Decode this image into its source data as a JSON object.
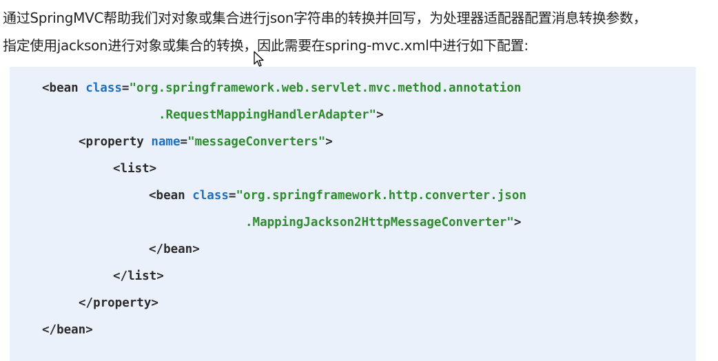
{
  "intro": {
    "line1": "通过SpringMVC帮助我们对对象或集合进行json字符串的转换并回写，为处理器适配器配置消息转换参数，",
    "line2": "指定使用jackson进行对象或集合的转换，因此需要在spring-mvc.xml中进行如下配置:"
  },
  "code": {
    "l1_open": "<bean ",
    "l1_attr": "class",
    "l1_eq": "=",
    "l1_val": "\"org.springframework.web.servlet.mvc.method.annotation",
    "l2_val": ".RequestMappingHandlerAdapter\"",
    "l2_close": ">",
    "l3_open": "<property ",
    "l3_attr": "name",
    "l3_eq": "=",
    "l3_val": "\"messageConverters\"",
    "l3_close": ">",
    "l4": "<list>",
    "l5_open": "<bean ",
    "l5_attr": "class",
    "l5_eq": "=",
    "l5_val": "\"org.springframework.http.converter.json",
    "l6_val": ".MappingJackson2HttpMessageConverter\"",
    "l6_close": ">",
    "l7": "</bean>",
    "l8": "</list>",
    "l9": "</property>",
    "l10": "</bean>"
  },
  "icons": {
    "cursor": "mouse-pointer-icon"
  }
}
